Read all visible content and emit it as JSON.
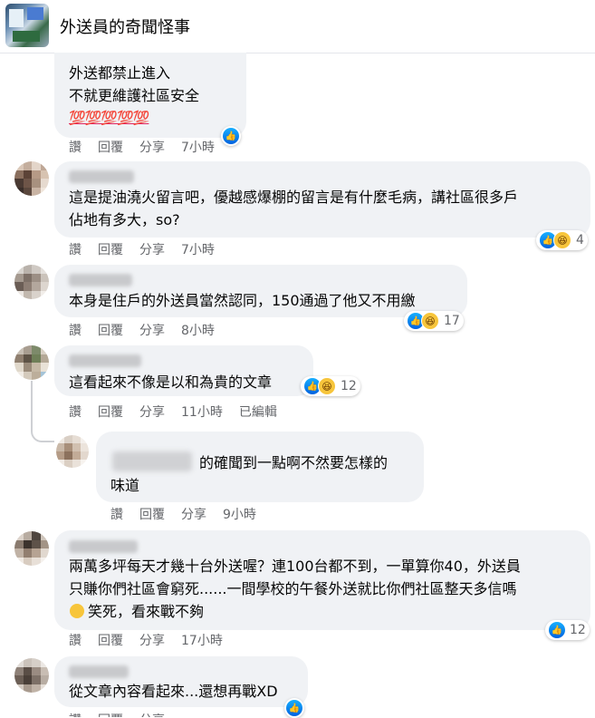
{
  "header": {
    "group_name": "外送員的奇聞怪事"
  },
  "actions": {
    "read": "讚",
    "reply": "回覆",
    "share": "分享",
    "edited": "已編輯"
  },
  "comments": [
    {
      "lines": [
        "外送都禁止進入",
        "不就更維護社區安全"
      ],
      "emoji_line": "💯💯💯💯💯",
      "time": "7小時",
      "reactions": {
        "count": ""
      }
    },
    {
      "lines": [
        "這是提油澆火留言吧，優越感爆棚的留言是有什麼毛病，講社區很多戶",
        "佔地有多大，so?"
      ],
      "time": "7小時",
      "reactions": {
        "count": "4"
      }
    },
    {
      "lines": [
        "本身是住戶的外送員當然認同，150通過了他又不用繳"
      ],
      "time": "8小時",
      "reactions": {
        "count": "17"
      }
    },
    {
      "lines": [
        "這看起來不像是以和為貴的文章"
      ],
      "time": "11小時",
      "reactions": {
        "count": "12"
      }
    },
    {
      "lines": [
        "的確聞到一點啊不然要怎樣的",
        "味道"
      ],
      "time": "9小時"
    },
    {
      "lines": [
        "兩萬多坪每天才幾十台外送喔？連100台都不到，一單算你40，外送員",
        "只賺你們社區會窮死......一間學校的午餐外送就比你們社區整天多信嗎",
        "笑死，看來戰不夠"
      ],
      "time": "17小時",
      "reactions": {
        "count": "12"
      }
    },
    {
      "lines": [
        "從文章內容看起來...還想再戰XD"
      ]
    }
  ],
  "colors": {
    "bubble": "#f0f2f5",
    "like": "#1877f2",
    "muted": "#65676b"
  },
  "icons": [
    "like-icon",
    "haha-icon"
  ]
}
